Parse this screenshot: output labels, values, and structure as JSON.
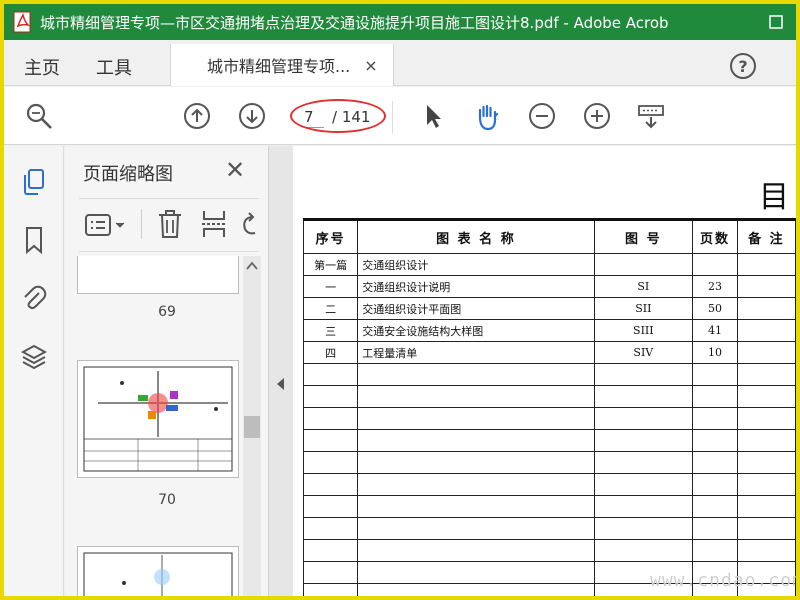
{
  "window": {
    "title": "城市精细管理专项—市区交通拥堵点治理及交通设施提升项目施工图设计8.pdf - Adobe Acrob",
    "colors": {
      "titlebar": "#1f8a3c",
      "frame": "#e8d800",
      "accent": "#2a6fd6",
      "highlight": "#e03030"
    }
  },
  "menu": {
    "home": "主页",
    "tools": "工具"
  },
  "tab": {
    "label": "城市精细管理专项...",
    "close": "×"
  },
  "help": {
    "icon": "help-icon",
    "glyph": "?"
  },
  "toolbar": {
    "current_page": "7",
    "total_pages": "/ 141",
    "icons": [
      "search-zoom-icon",
      "previous-page-icon",
      "next-page-icon",
      "select-arrow-icon",
      "hand-tool-icon",
      "zoom-out-icon",
      "zoom-in-icon",
      "keyboard-scroll-icon"
    ]
  },
  "sidebar": {
    "icons": [
      "page-thumbnails-icon",
      "bookmark-icon",
      "attachment-icon",
      "layers-icon"
    ]
  },
  "thumbnails": {
    "title": "页面缩略图",
    "close": "✕",
    "pages": [
      "69",
      "70"
    ]
  },
  "document": {
    "heading": "目",
    "table": {
      "headers": [
        "序号",
        "图 表 名 称",
        "图 号",
        "页数",
        "备 注"
      ],
      "section_no": "第一篇",
      "section_title": "交通组织设计",
      "rows": [
        {
          "no": "一",
          "name": "交通组织设计说明",
          "code": "SI",
          "pages": "23"
        },
        {
          "no": "二",
          "name": "交通组织设计平面图",
          "code": "SII",
          "pages": "50"
        },
        {
          "no": "三",
          "name": "交通安全设施结构大样图",
          "code": "SIII",
          "pages": "41"
        },
        {
          "no": "四",
          "name": "工程量清单",
          "code": "SIV",
          "pages": "10"
        }
      ]
    }
  },
  "watermark": "www.cndao.com"
}
